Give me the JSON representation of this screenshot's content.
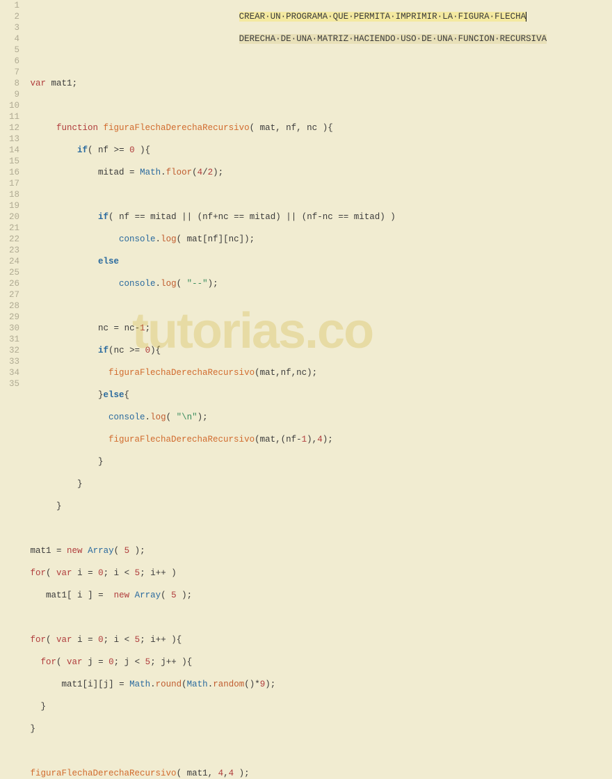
{
  "watermark": "tutorias.co",
  "comment_line1_pre": "                                         ",
  "comment_line1": "CREAR·UN·PROGRAMA·QUE·PERMITA·IMPRIMIR·LA·FIGURA·FLECHA",
  "comment_line2_pre": "                                         ",
  "comment_line2": "DERECHA·DE·UNA·MATRIZ·HACIENDO·USO·DE·UNA·FUNCION·RECURSIVA",
  "gutter": [
    "1",
    "2",
    "3",
    "4",
    "5",
    "6",
    "7",
    "8",
    "9",
    "10",
    "11",
    "12",
    "13",
    "14",
    "15",
    "16",
    "17",
    "18",
    "19",
    "20",
    "21",
    "22",
    "23",
    "24",
    "25",
    "26",
    "27",
    "28",
    "29",
    "30",
    "31",
    "32",
    "33",
    "34",
    "35"
  ],
  "t": {
    "var": "var",
    "function": "function",
    "new": "new",
    "for": "for",
    "if": "if",
    "else": "else",
    "Array": "Array",
    "Math": "Math",
    "console": "console",
    "floor": "floor",
    "log": "log",
    "round": "round",
    "random": "random",
    "mat1": "mat1",
    "mat": "mat",
    "nf": "nf",
    "nc": "nc",
    "mitad": "mitad",
    "fnName": "figuraFlechaDerechaRecursivo",
    "i": "i",
    "j": "j",
    "s_dash": "\"--\"",
    "s_nl": "\"\\n\"",
    "n0": "0",
    "n1": "1",
    "n2": "2",
    "n4": "4",
    "n4b": "4",
    "n5": "5",
    "n9": "9"
  }
}
